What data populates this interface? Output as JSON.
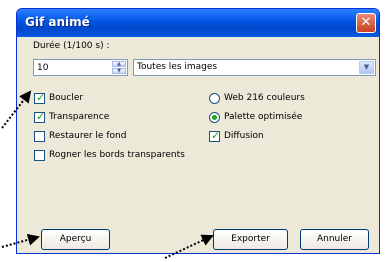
{
  "window": {
    "title": "Gif animé"
  },
  "duration": {
    "label": "Durée (1/100 s) :",
    "value": "10"
  },
  "frames_select": {
    "selected": "Toutes les images"
  },
  "checkboxes": [
    {
      "label": "Boucler",
      "checked": true
    },
    {
      "label": "Transparence",
      "checked": true
    },
    {
      "label": "Restaurer le fond",
      "checked": false
    },
    {
      "label": "Rogner les bords transparents",
      "checked": false
    }
  ],
  "palette": [
    {
      "label": "Web 216 couleurs",
      "selected": false
    },
    {
      "label": "Palette optimisée",
      "selected": true
    }
  ],
  "diffusion": {
    "label": "Diffusion",
    "checked": true
  },
  "buttons": {
    "preview": "Aperçu",
    "export": "Exporter",
    "cancel": "Annuler"
  }
}
